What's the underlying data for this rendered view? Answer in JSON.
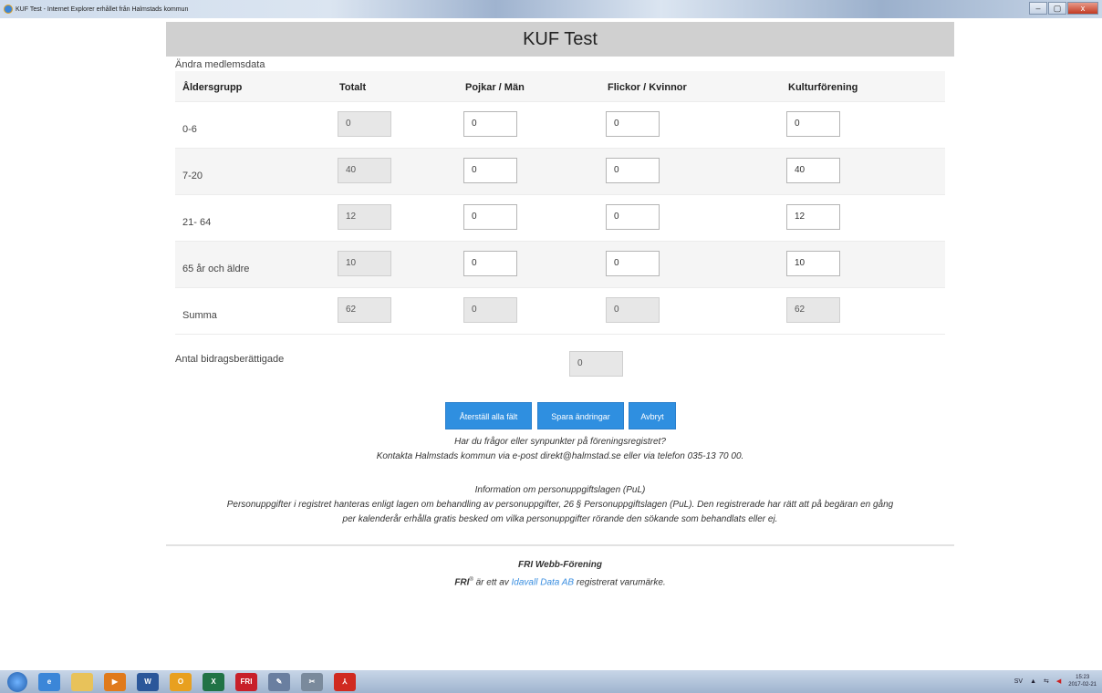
{
  "window": {
    "title": "KUF Test - Internet Explorer erhållet från Halmstads kommun",
    "minimize": "–",
    "maximize": "▢",
    "close": "x"
  },
  "page": {
    "title": "KUF Test",
    "section": "Ändra medlemsdata"
  },
  "table": {
    "headers": [
      "Åldersgrupp",
      "Totalt",
      "Pojkar / Män",
      "Flickor / Kvinnor",
      "Kulturförening"
    ],
    "rows": [
      {
        "label": "0-6",
        "totalt": "0",
        "pojkar": "0",
        "flickor": "0",
        "kultur": "0"
      },
      {
        "label": "7-20",
        "totalt": "40",
        "pojkar": "0",
        "flickor": "0",
        "kultur": "40"
      },
      {
        "label": "21- 64",
        "totalt": "12",
        "pojkar": "0",
        "flickor": "0",
        "kultur": "12"
      },
      {
        "label": "65 år och äldre",
        "totalt": "10",
        "pojkar": "0",
        "flickor": "0",
        "kultur": "10"
      },
      {
        "label": "Summa",
        "totalt": "62",
        "pojkar": "0",
        "flickor": "0",
        "kultur": "62"
      }
    ]
  },
  "antal": {
    "label": "Antal bidragsberättigade",
    "value": "0"
  },
  "buttons": {
    "reset": "Återställ alla fält",
    "save": "Spara ändringar",
    "cancel": "Avbryt"
  },
  "contact": {
    "question": "Har du frågor eller synpunkter på föreningsregistret?",
    "line": "Kontakta Halmstads kommun via e-post direkt@halmstad.se eller via telefon 035-13 70 00."
  },
  "pul": {
    "title": "Information om personuppgiftslagen (PuL)",
    "line1": "Personuppgifter i registret hanteras enligt lagen om behandling av personuppgifter, 26 § Personuppgiftslagen (PuL). Den registrerade har rätt att på begäran en gång",
    "line2": "per kalenderår erhålla gratis besked om vilka personuppgifter rörande den sökande som behandlats eller ej."
  },
  "footer": {
    "product": "FRI Webb-Förening",
    "brand": "FRI",
    "registered": "®",
    "mid": " är ett av ",
    "company": "Idavall Data AB",
    "end": " registrerat varumärke."
  },
  "taskbar": {
    "apps": [
      {
        "icon": "start-orb-icon",
        "label": "",
        "color": "#2a6ec0"
      },
      {
        "icon": "internet-explorer-icon",
        "label": "e",
        "color": "#3b86d8"
      },
      {
        "icon": "folder-icon",
        "label": "",
        "color": "#e8c25a"
      },
      {
        "icon": "media-player-icon",
        "label": "▶",
        "color": "#e07a1c"
      },
      {
        "icon": "word-icon",
        "label": "W",
        "color": "#2b579a"
      },
      {
        "icon": "outlook-icon",
        "label": "O",
        "color": "#e8a020"
      },
      {
        "icon": "excel-icon",
        "label": "X",
        "color": "#217346"
      },
      {
        "icon": "fri-app-icon",
        "label": "FRI",
        "color": "#c8202a"
      },
      {
        "icon": "paint-icon",
        "label": "✎",
        "color": "#6a7fa0"
      },
      {
        "icon": "tools-icon",
        "label": "✂",
        "color": "#7a8a9c"
      },
      {
        "icon": "pdf-icon",
        "label": "⅄",
        "color": "#d02a20"
      }
    ],
    "language": "SV",
    "time": "15:23",
    "date": "2017-02-21"
  }
}
